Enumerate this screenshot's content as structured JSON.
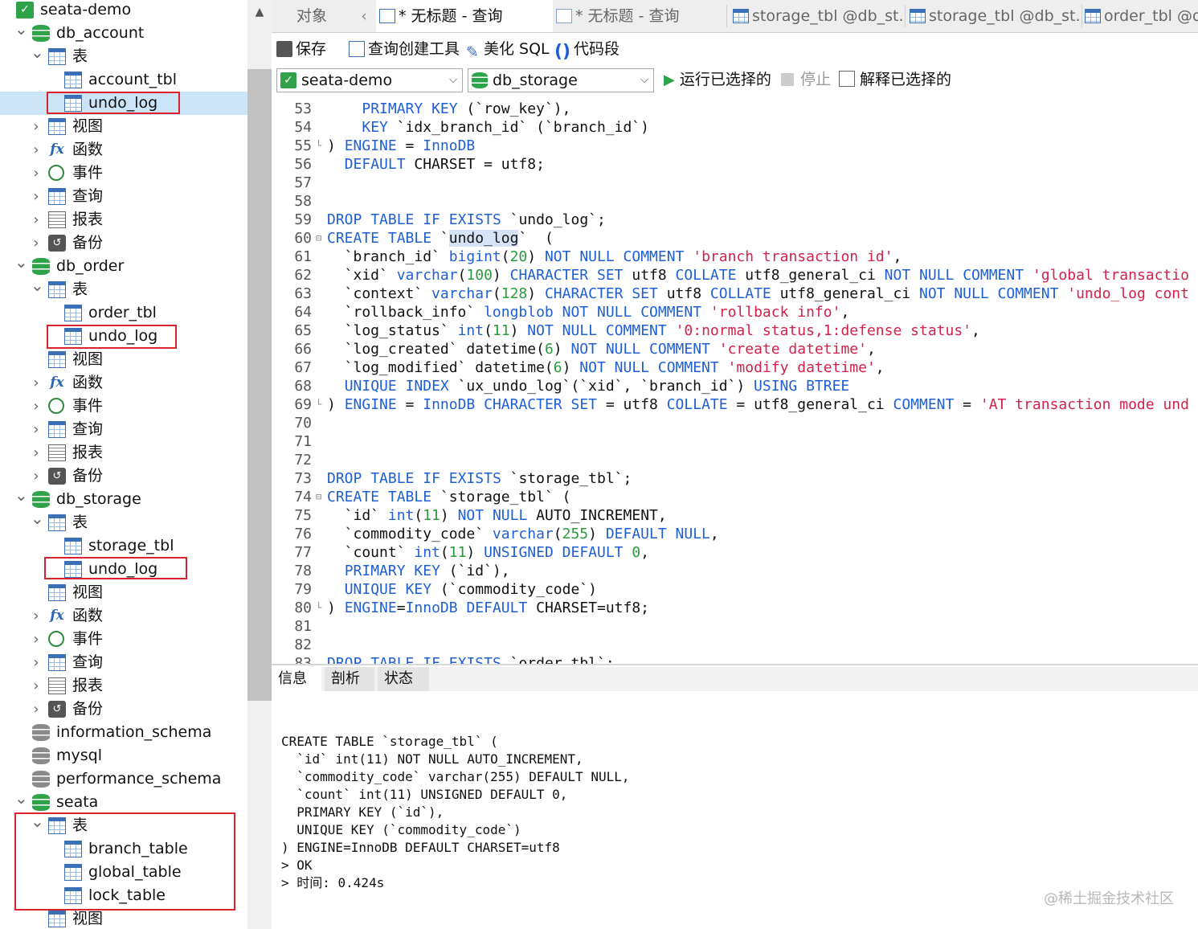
{
  "sidebar": {
    "rows": [
      {
        "label": "seata-demo",
        "icon": "connection-icon"
      },
      {
        "label": "db_account",
        "icon": "database-icon"
      },
      {
        "label": "表",
        "icon": "tables-folder-icon"
      },
      {
        "label": "account_tbl",
        "icon": "table-icon"
      },
      {
        "label": "undo_log",
        "icon": "table-icon"
      },
      {
        "label": "视图",
        "icon": "view-icon"
      },
      {
        "label": "函数",
        "icon": "function-icon"
      },
      {
        "label": "事件",
        "icon": "event-icon"
      },
      {
        "label": "查询",
        "icon": "query-icon"
      },
      {
        "label": "报表",
        "icon": "report-icon"
      },
      {
        "label": "备份",
        "icon": "backup-icon"
      },
      {
        "label": "db_order",
        "icon": "database-icon"
      },
      {
        "label": "表",
        "icon": "tables-folder-icon"
      },
      {
        "label": "order_tbl",
        "icon": "table-icon"
      },
      {
        "label": "undo_log",
        "icon": "table-icon"
      },
      {
        "label": "视图",
        "icon": "view-icon"
      },
      {
        "label": "函数",
        "icon": "function-icon"
      },
      {
        "label": "事件",
        "icon": "event-icon"
      },
      {
        "label": "查询",
        "icon": "query-icon"
      },
      {
        "label": "报表",
        "icon": "report-icon"
      },
      {
        "label": "备份",
        "icon": "backup-icon"
      },
      {
        "label": "db_storage",
        "icon": "database-icon"
      },
      {
        "label": "表",
        "icon": "tables-folder-icon"
      },
      {
        "label": "storage_tbl",
        "icon": "table-icon"
      },
      {
        "label": "undo_log",
        "icon": "table-icon"
      },
      {
        "label": "视图",
        "icon": "view-icon"
      },
      {
        "label": "函数",
        "icon": "function-icon"
      },
      {
        "label": "事件",
        "icon": "event-icon"
      },
      {
        "label": "查询",
        "icon": "query-icon"
      },
      {
        "label": "报表",
        "icon": "report-icon"
      },
      {
        "label": "备份",
        "icon": "backup-icon"
      },
      {
        "label": "information_schema",
        "icon": "database-icon"
      },
      {
        "label": "mysql",
        "icon": "database-icon"
      },
      {
        "label": "performance_schema",
        "icon": "database-icon"
      },
      {
        "label": "seata",
        "icon": "database-icon"
      },
      {
        "label": "表",
        "icon": "tables-folder-icon"
      },
      {
        "label": "branch_table",
        "icon": "table-icon"
      },
      {
        "label": "global_table",
        "icon": "table-icon"
      },
      {
        "label": "lock_table",
        "icon": "table-icon"
      },
      {
        "label": "视图",
        "icon": "view-icon"
      }
    ]
  },
  "tabs": [
    {
      "label": "对象"
    },
    {
      "label": "* 无标题 - 查询"
    },
    {
      "label": "* 无标题 - 查询"
    },
    {
      "label": "storage_tbl @db_st..."
    },
    {
      "label": "storage_tbl @db_st..."
    },
    {
      "label": "order_tbl @d"
    }
  ],
  "toolbar": {
    "save": "保存",
    "query_builder": "查询创建工具",
    "beautify": "美化 SQL",
    "snippet": "代码段",
    "connection": "seata-demo",
    "database": "db_storage",
    "run_selected": "运行已选择的",
    "stop": "停止",
    "explain_selected": "解释已选择的"
  },
  "editor": {
    "lines": [
      {
        "n": "53",
        "t": "    PRIMARY KEY (`row_key`),"
      },
      {
        "n": "54",
        "t": "    KEY `idx_branch_id` (`branch_id`)"
      },
      {
        "n": "55",
        "t": ") ENGINE = InnoDB"
      },
      {
        "n": "56",
        "t": "  DEFAULT CHARSET = utf8;"
      },
      {
        "n": "57",
        "t": ""
      },
      {
        "n": "58",
        "t": ""
      },
      {
        "n": "59",
        "t": "DROP TABLE IF EXISTS `undo_log`;"
      },
      {
        "n": "60",
        "t": "CREATE TABLE `undo_log`  ("
      },
      {
        "n": "61",
        "t": "  `branch_id` bigint(20) NOT NULL COMMENT 'branch transaction id',"
      },
      {
        "n": "62",
        "t": "  `xid` varchar(100) CHARACTER SET utf8 COLLATE utf8_general_ci NOT NULL COMMENT 'global transactio"
      },
      {
        "n": "63",
        "t": "  `context` varchar(128) CHARACTER SET utf8 COLLATE utf8_general_ci NOT NULL COMMENT 'undo_log cont"
      },
      {
        "n": "64",
        "t": "  `rollback_info` longblob NOT NULL COMMENT 'rollback info',"
      },
      {
        "n": "65",
        "t": "  `log_status` int(11) NOT NULL COMMENT '0:normal status,1:defense status',"
      },
      {
        "n": "66",
        "t": "  `log_created` datetime(6) NOT NULL COMMENT 'create datetime',"
      },
      {
        "n": "67",
        "t": "  `log_modified` datetime(6) NOT NULL COMMENT 'modify datetime',"
      },
      {
        "n": "68",
        "t": "  UNIQUE INDEX `ux_undo_log`(`xid`, `branch_id`) USING BTREE"
      },
      {
        "n": "69",
        "t": ") ENGINE = InnoDB CHARACTER SET = utf8 COLLATE = utf8_general_ci COMMENT = 'AT transaction mode und"
      },
      {
        "n": "70",
        "t": ""
      },
      {
        "n": "71",
        "t": ""
      },
      {
        "n": "72",
        "t": ""
      },
      {
        "n": "73",
        "t": "DROP TABLE IF EXISTS `storage_tbl`;"
      },
      {
        "n": "74",
        "t": "CREATE TABLE `storage_tbl` ("
      },
      {
        "n": "75",
        "t": "  `id` int(11) NOT NULL AUTO_INCREMENT,"
      },
      {
        "n": "76",
        "t": "  `commodity_code` varchar(255) DEFAULT NULL,"
      },
      {
        "n": "77",
        "t": "  `count` int(11) UNSIGNED DEFAULT 0,"
      },
      {
        "n": "78",
        "t": "  PRIMARY KEY (`id`),"
      },
      {
        "n": "79",
        "t": "  UNIQUE KEY (`commodity_code`)"
      },
      {
        "n": "80",
        "t": ") ENGINE=InnoDB DEFAULT CHARSET=utf8;"
      },
      {
        "n": "81",
        "t": ""
      },
      {
        "n": "82",
        "t": ""
      },
      {
        "n": "83",
        "t": "DROP TABLE IF EXISTS `order_tbl`;"
      }
    ]
  },
  "bottom_tabs": [
    {
      "label": "信息"
    },
    {
      "label": "剖析"
    },
    {
      "label": "状态"
    }
  ],
  "output": {
    "lines": [
      "CREATE TABLE `storage_tbl` (",
      "  `id` int(11) NOT NULL AUTO_INCREMENT,",
      "  `commodity_code` varchar(255) DEFAULT NULL,",
      "  `count` int(11) UNSIGNED DEFAULT 0,",
      "  PRIMARY KEY (`id`),",
      "  UNIQUE KEY (`commodity_code`)",
      ") ENGINE=InnoDB DEFAULT CHARSET=utf8",
      "> OK",
      "> 时间: 0.424s"
    ]
  },
  "watermark": "@稀土掘金技术社区",
  "colors": {
    "keyword": "#1f5fd6",
    "string": "#d4204a",
    "number": "#2b9a3a",
    "highlight_box": "#d9232e",
    "selection": "#cce4f7"
  }
}
